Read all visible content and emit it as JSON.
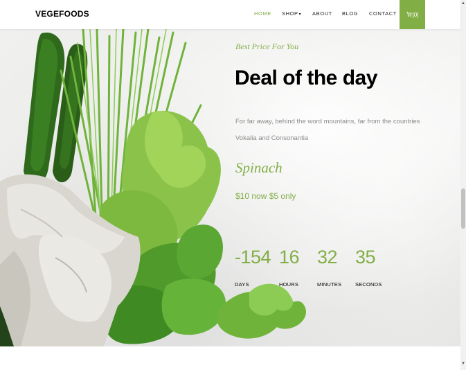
{
  "nav": {
    "brand": "VEGEFOODS",
    "items": [
      {
        "label": "HOME",
        "active": true
      },
      {
        "label": "SHOP",
        "caret": "▾"
      },
      {
        "label": "ABOUT"
      },
      {
        "label": "BLOG"
      },
      {
        "label": "CONTACT"
      }
    ],
    "cart_count": "[0]",
    "cart_icon": "cart-icon"
  },
  "deal": {
    "subtitle": "Best Price For You",
    "title": "Deal of the day",
    "description": "For far away, behind the word mountains, far from the countries Vokalia and Consonantia",
    "product": "Spinach",
    "price_old": "$10",
    "price_word": "now",
    "price_new": "$5 only"
  },
  "countdown": [
    {
      "value": "-154",
      "label": "DAYS"
    },
    {
      "value": "16",
      "label": "HOURS"
    },
    {
      "value": "32",
      "label": "MINUTES"
    },
    {
      "value": "35",
      "label": "SECONDS"
    }
  ],
  "colors": {
    "accent": "#82ae46",
    "text": "#000000",
    "muted": "#8a8a8a"
  }
}
